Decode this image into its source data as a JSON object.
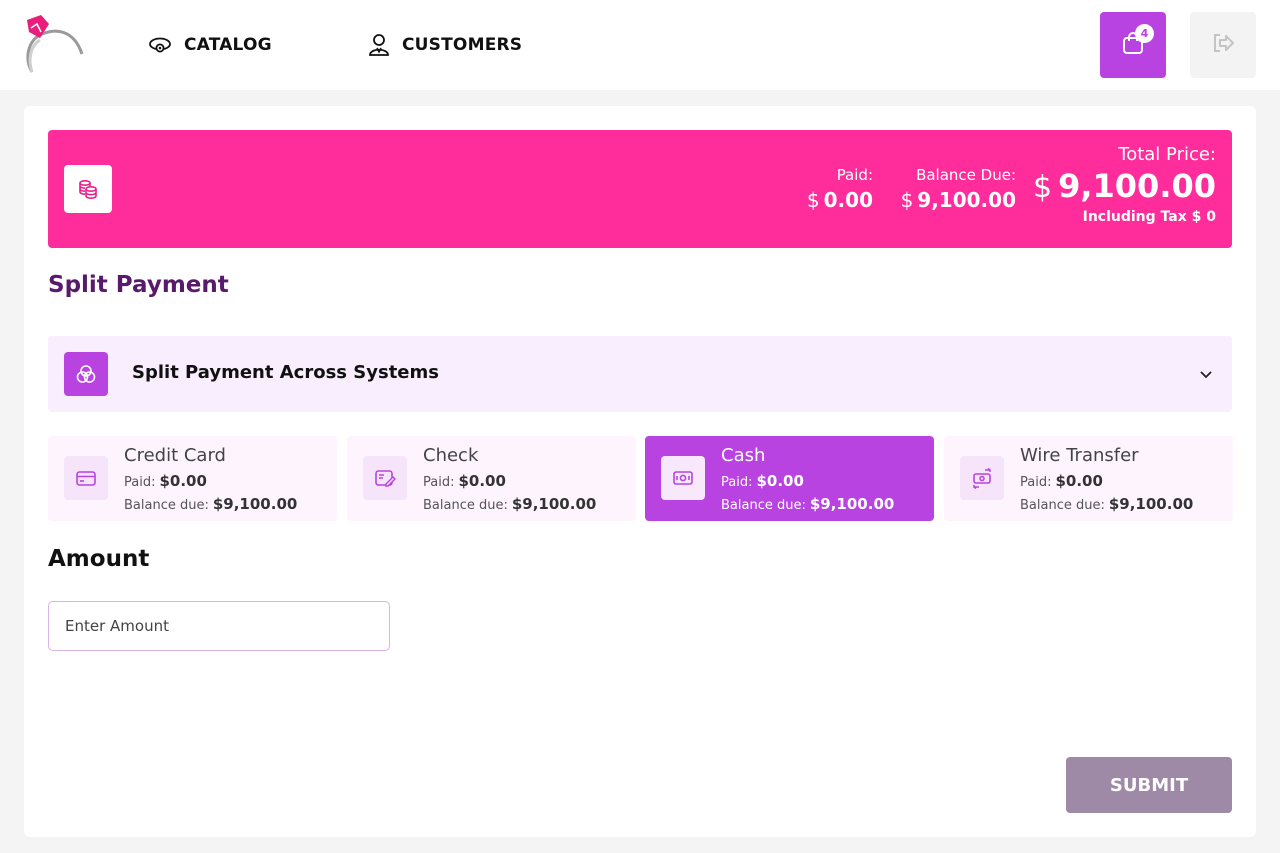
{
  "header": {
    "nav": [
      {
        "label": "CATALOG",
        "icon": "ring-icon"
      },
      {
        "label": "CUSTOMERS",
        "icon": "user-icon"
      }
    ],
    "cart_count": "4",
    "accent": "#b943e0"
  },
  "banner": {
    "color": "#ff2d9b",
    "paid_label": "Paid:",
    "paid_currency": "$",
    "paid_value": "0.00",
    "balance_label": "Balance Due:",
    "balance_currency": "$",
    "balance_value": "9,100.00",
    "total_label": "Total Price:",
    "total_currency": "$",
    "total_value": "9,100.00",
    "tax_text": "Including Tax $ 0"
  },
  "section_title": "Split Payment",
  "accordion": {
    "label": "Split Payment Across Systems",
    "icon": "overlap-circles-icon"
  },
  "methods": [
    {
      "name": "Credit Card",
      "paid_label": "Paid:",
      "paid": "$0.00",
      "balance_label": "Balance due:",
      "balance": "$9,100.00",
      "icon": "credit-card-icon",
      "active": false
    },
    {
      "name": "Check",
      "paid_label": "Paid:",
      "paid": "$0.00",
      "balance_label": "Balance due:",
      "balance": "$9,100.00",
      "icon": "check-icon",
      "active": false
    },
    {
      "name": "Cash",
      "paid_label": "Paid:",
      "paid": "$0.00",
      "balance_label": "Balance due:",
      "balance": "$9,100.00",
      "icon": "cash-icon",
      "active": true
    },
    {
      "name": "Wire Transfer",
      "paid_label": "Paid:",
      "paid": "$0.00",
      "balance_label": "Balance due:",
      "balance": "$9,100.00",
      "icon": "transfer-icon",
      "active": false
    }
  ],
  "amount": {
    "title": "Amount",
    "placeholder": "Enter Amount",
    "value": ""
  },
  "submit_label": "SUBMIT"
}
